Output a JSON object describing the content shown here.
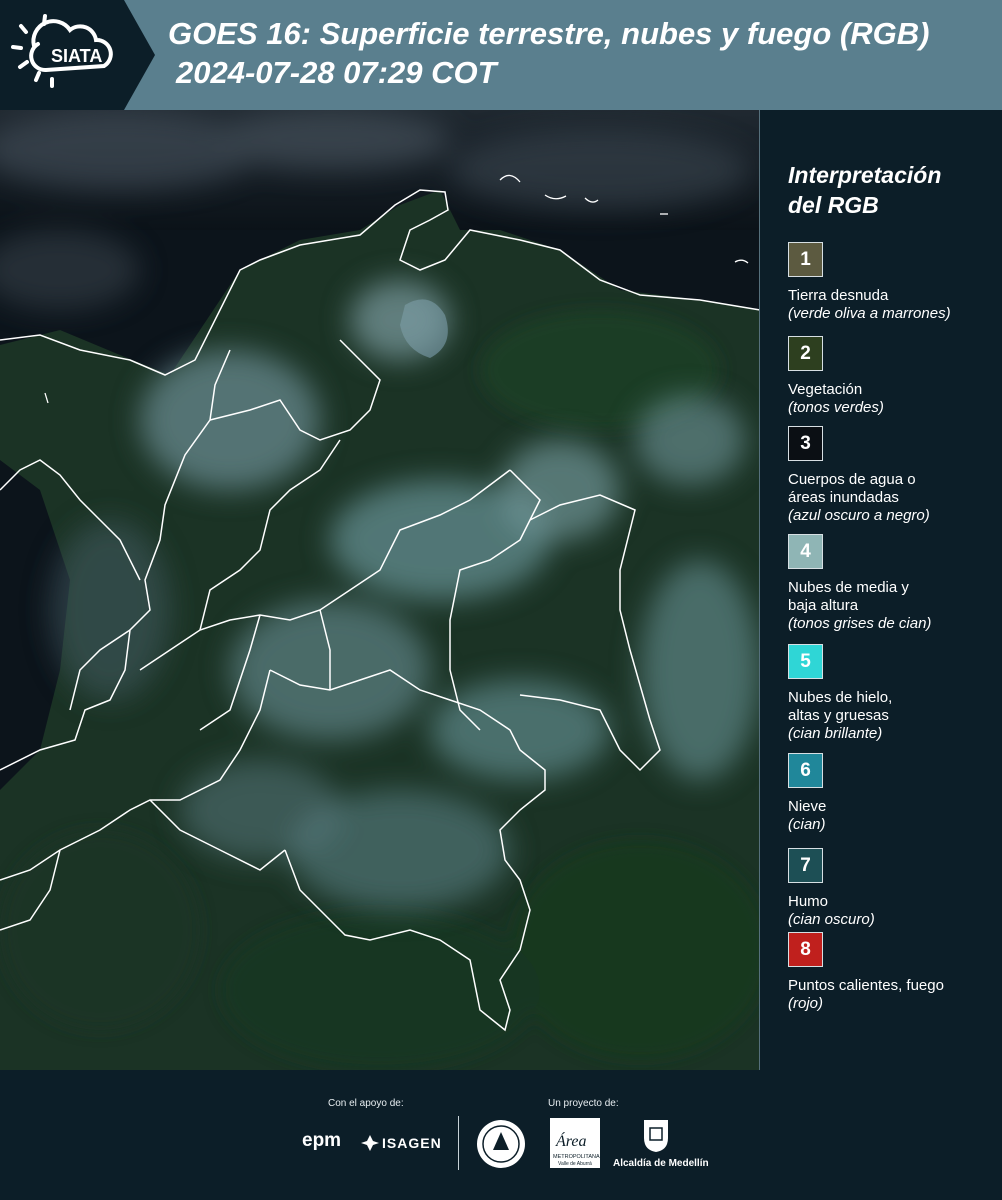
{
  "header": {
    "logo_text": "SIATA",
    "title": "GOES 16: Superficie terrestre, nubes y fuego (RGB)",
    "timestamp": "2024-07-28 07:29 COT"
  },
  "legend": {
    "title_line1": "Interpretación",
    "title_line2": "del RGB",
    "items": [
      {
        "num": "1",
        "label": "Tierra desnuda",
        "desc": "(verde oliva a marrones)",
        "color": "#5c5a40",
        "text_color": "#ffffff"
      },
      {
        "num": "2",
        "label": "Vegetación",
        "desc": "(tonos verdes)",
        "color": "#2d3f1f",
        "text_color": "#ffffff"
      },
      {
        "num": "3",
        "label": "Cuerpos de agua o",
        "label2": "áreas inundadas",
        "desc": "(azul oscuro a negro)",
        "color": "#0b0f14",
        "text_color": "#ffffff"
      },
      {
        "num": "4",
        "label": "Nubes de media y",
        "label2": "baja altura",
        "desc": "(tonos grises de cian)",
        "color": "#8fb5b5",
        "text_color": "#ffffff"
      },
      {
        "num": "5",
        "label": "Nubes de hielo,",
        "label2": "altas y gruesas",
        "desc": "(cian brillante)",
        "color": "#2fd6d6",
        "text_color": "#ffffff"
      },
      {
        "num": "6",
        "label": "Nieve",
        "desc": "(cian)",
        "color": "#20879a",
        "text_color": "#ffffff"
      },
      {
        "num": "7",
        "label": "Humo",
        "desc": "(cian oscuro)",
        "color": "#1d4f55",
        "text_color": "#ffffff"
      },
      {
        "num": "8",
        "label": "Puntos calientes, fuego",
        "desc": "(rojo)",
        "color": "#c0201d",
        "text_color": "#ffffff"
      }
    ]
  },
  "footer": {
    "support_label": "Con el apoyo de:",
    "project_label": "Un proyecto de:",
    "epm": "epm",
    "isagen": "ISAGEN",
    "area_word": "Área",
    "area_sub1": "METROPOLITANA",
    "area_sub2": "Valle de Aburrá",
    "alcaldia": "Alcaldía de Medellín"
  },
  "colors": {
    "header_bg": "#5a7f8e",
    "logo_panel_bg": "#0c1e28",
    "page_bg": "#0c1e28",
    "ocean": "#0b1218",
    "land": "#1c3526",
    "cloud": "#7aa6ab",
    "border_lines": "#ffffff"
  }
}
